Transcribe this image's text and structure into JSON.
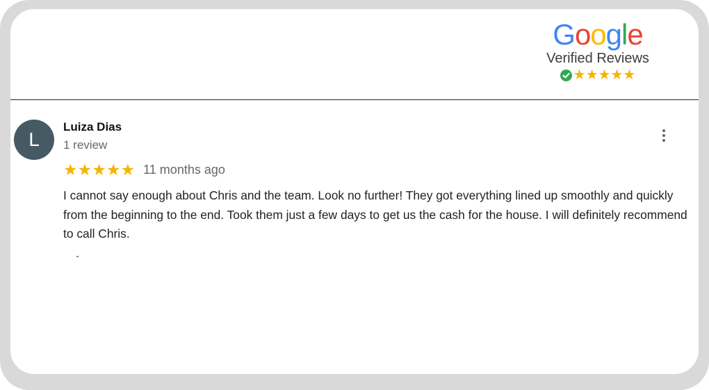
{
  "colors": {
    "frame": "#d9d9d9",
    "star": "#f5b400",
    "check": "#34a853",
    "avatar": "#455a64",
    "google_blue": "#4285F4",
    "google_red": "#EA4335",
    "google_yellow": "#FBBC05",
    "google_green": "#34A853"
  },
  "badge": {
    "letters": [
      "G",
      "o",
      "o",
      "g",
      "l",
      "e"
    ],
    "subtitle": "Verified Reviews",
    "rating": 5,
    "check_icon": "check-circle-icon"
  },
  "review": {
    "avatar_initial": "L",
    "author": "Luiza Dias",
    "review_count": "1 review",
    "rating": 5,
    "time": "11 months ago",
    "text": "I cannot say enough about Chris and the team. Look no further! They got everything lined up smoothly and quickly from the beginning to the end. Took them just a few days to get us the cash for the house. I will definitely recommend to call Chris.",
    "menu_icon": "more-vertical-icon"
  }
}
